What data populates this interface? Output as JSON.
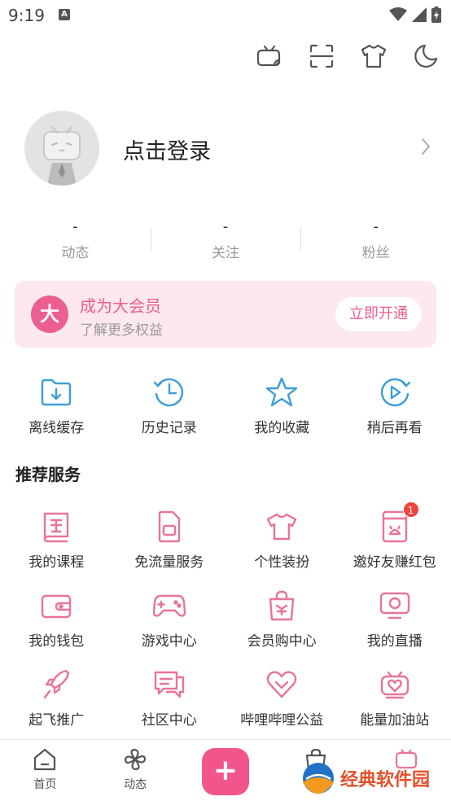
{
  "status_bar": {
    "time": "9:19",
    "notification_letter": "A"
  },
  "top_tools": [
    {
      "name": "tv-cast-icon"
    },
    {
      "name": "scan-icon"
    },
    {
      "name": "tshirt-icon"
    },
    {
      "name": "night-mode-icon"
    }
  ],
  "profile": {
    "login_label": "点击登录"
  },
  "stats": [
    {
      "value": "-",
      "label": "动态"
    },
    {
      "value": "-",
      "label": "关注"
    },
    {
      "value": "-",
      "label": "粉丝"
    }
  ],
  "vip": {
    "badge": "大",
    "title": "成为大会员",
    "subtitle": "了解更多权益",
    "button": "立即开通"
  },
  "quick_actions": [
    {
      "label": "离线缓存",
      "icon": "offline-cache-icon"
    },
    {
      "label": "历史记录",
      "icon": "history-icon"
    },
    {
      "label": "我的收藏",
      "icon": "star-icon"
    },
    {
      "label": "稍后再看",
      "icon": "watch-later-icon"
    }
  ],
  "services_title": "推荐服务",
  "services": [
    {
      "label": "我的课程",
      "icon": "course-icon"
    },
    {
      "label": "免流量服务",
      "icon": "sim-card-icon"
    },
    {
      "label": "个性装扮",
      "icon": "tshirt-icon"
    },
    {
      "label": "邀好友赚红包",
      "icon": "red-packet-icon",
      "badge": "1"
    },
    {
      "label": "我的钱包",
      "icon": "wallet-icon"
    },
    {
      "label": "游戏中心",
      "icon": "gamepad-icon"
    },
    {
      "label": "会员购中心",
      "icon": "shopping-bag-icon"
    },
    {
      "label": "我的直播",
      "icon": "live-tv-icon"
    },
    {
      "label": "起飞推广",
      "icon": "rocket-icon"
    },
    {
      "label": "社区中心",
      "icon": "chat-icon"
    },
    {
      "label": "哔哩哔哩公益",
      "icon": "heart-icon"
    },
    {
      "label": "能量加油站",
      "icon": "energy-station-icon"
    }
  ],
  "bottom_nav": [
    {
      "label": "首页",
      "icon": "home-icon"
    },
    {
      "label": "动态",
      "icon": "pinwheel-icon"
    },
    {
      "label": "",
      "icon": "plus-icon"
    },
    {
      "label": "",
      "icon": "shop-icon"
    },
    {
      "label": "",
      "icon": "tv-icon"
    }
  ],
  "plus_symbol": "+",
  "watermark": {
    "text": "经典软件园"
  },
  "colors": {
    "accent": "#ec6091",
    "vip_bg": "#fde8ee",
    "icon_blue": "#3c9ed6",
    "icon_pink": "#e8739b"
  }
}
